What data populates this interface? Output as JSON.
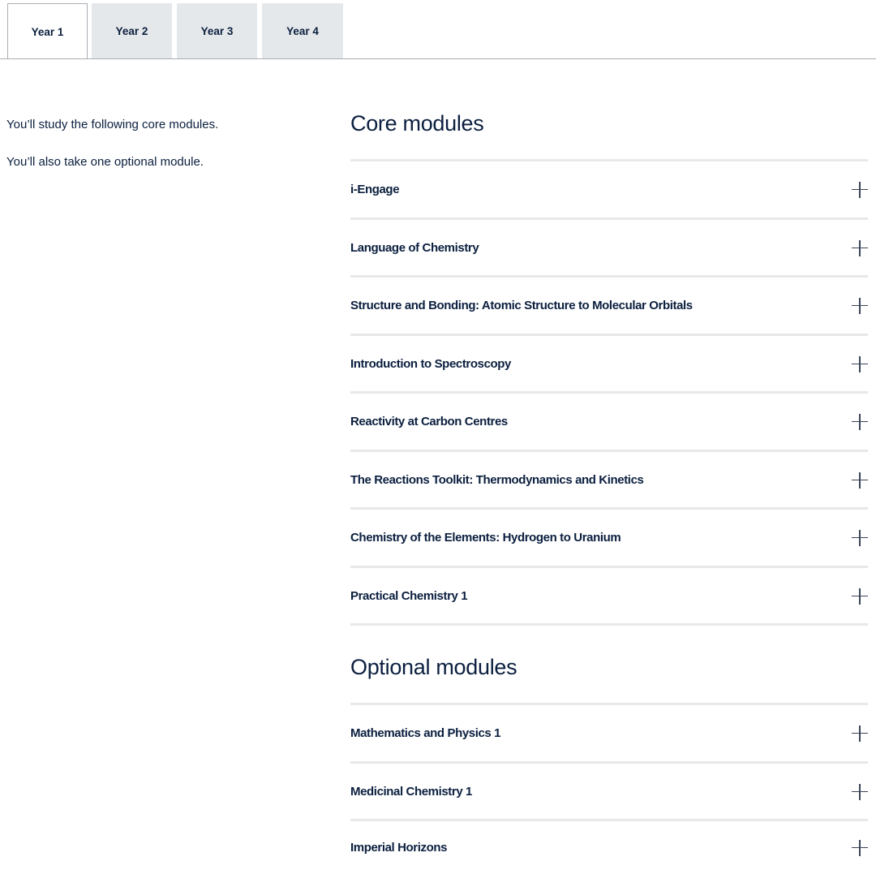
{
  "tabs": [
    {
      "label": "Year 1",
      "active": true
    },
    {
      "label": "Year 2",
      "active": false
    },
    {
      "label": "Year 3",
      "active": false
    },
    {
      "label": "Year 4",
      "active": false
    }
  ],
  "intro": {
    "line1": "You’ll study the following core modules.",
    "line2": "You’ll also take one optional module."
  },
  "core": {
    "title": "Core modules",
    "items": [
      {
        "label": "i-Engage"
      },
      {
        "label": "Language of Chemistry"
      },
      {
        "label": "Structure and Bonding: Atomic Structure to Molecular Orbitals"
      },
      {
        "label": "Introduction to Spectroscopy"
      },
      {
        "label": "Reactivity at Carbon Centres"
      },
      {
        "label": "The Reactions Toolkit: Thermodynamics and Kinetics"
      },
      {
        "label": "Chemistry of the Elements: Hydrogen to Uranium"
      },
      {
        "label": "Practical Chemistry 1"
      }
    ]
  },
  "optional": {
    "title": "Optional modules",
    "items": [
      {
        "label": "Mathematics and Physics 1"
      },
      {
        "label": "Medicinal Chemistry 1"
      },
      {
        "label": "Imperial Horizons"
      }
    ]
  },
  "icons": {
    "expand": "plus-icon"
  },
  "colors": {
    "text": "#0b1f3f",
    "tab_inactive": "#e5e8ea",
    "divider": "#e6e8ea"
  }
}
